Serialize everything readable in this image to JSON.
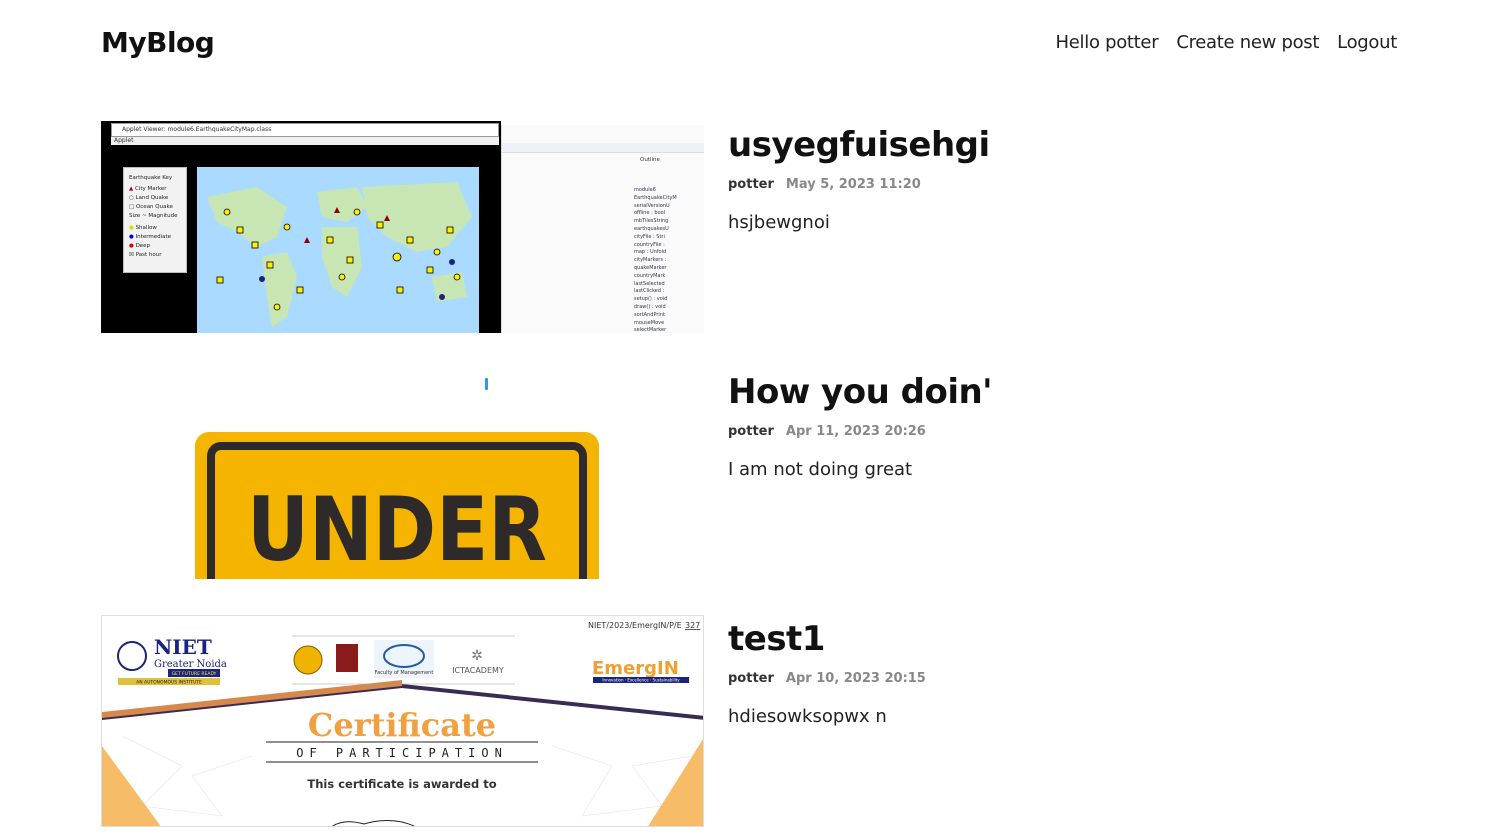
{
  "header": {
    "logo": "MyBlog",
    "nav": {
      "hello": "Hello potter",
      "create": "Create new post",
      "logout": "Logout"
    }
  },
  "posts": [
    {
      "title": "usyegfuisehgi",
      "author": "potter",
      "time": "May 5, 2023 11:20",
      "summary": "hsjbewgnoi",
      "image": {
        "window_title": "Applet Viewer: module6.EarthquakeCityMap.class",
        "menu": "Applet",
        "key_title": "Earthquake Key",
        "key_items": [
          "City Marker",
          "Land Quake",
          "Ocean Quake",
          "Size ~ Magnitude",
          "Shallow",
          "Intermediate",
          "Deep",
          "Past hour"
        ],
        "outline_title": "Outline",
        "outline_items": [
          "module6",
          "EarthquakeCityM",
          "serialVersionU",
          "offline : bool",
          "mbTilesString",
          "earthquakesU",
          "cityFile : Stri",
          "countryFile :",
          "map : Unfold",
          "cityMarkers :",
          "quakeMarker",
          "countryMark",
          "lastSelected",
          "lastClicked :",
          "setup() : void",
          "draw() : void",
          "sortAndPrint",
          "mouseMove",
          "selectMarker"
        ]
      }
    },
    {
      "title": "How you doin'",
      "author": "potter",
      "time": "Apr 11, 2023 20:26",
      "summary": "I am not doing great",
      "image": {
        "sign_text": "UNDER"
      }
    },
    {
      "title": "test1",
      "author": "potter",
      "time": "Apr 10, 2023 20:15",
      "summary": "hdiesowksopwx n",
      "image": {
        "ref_number": "NIET/2023/EmergIN/P/E",
        "ref_suffix": "327",
        "niet": "NIET",
        "niet_sub": "Greater Noida",
        "niet_tag": "GET FUTURE READY",
        "niet_auto": "AN AUTONOMOUS INSTITUTE",
        "faculty": "Faculty of Management",
        "ictacademy": "ICTACADEMY",
        "emergin": "EmergIN",
        "emergin_tag": "Innovation · Excellence · Sustainability",
        "certificate": "Certificate",
        "participation": "OF PARTICIPATION",
        "awarded": "This certificate is awarded to"
      }
    }
  ]
}
